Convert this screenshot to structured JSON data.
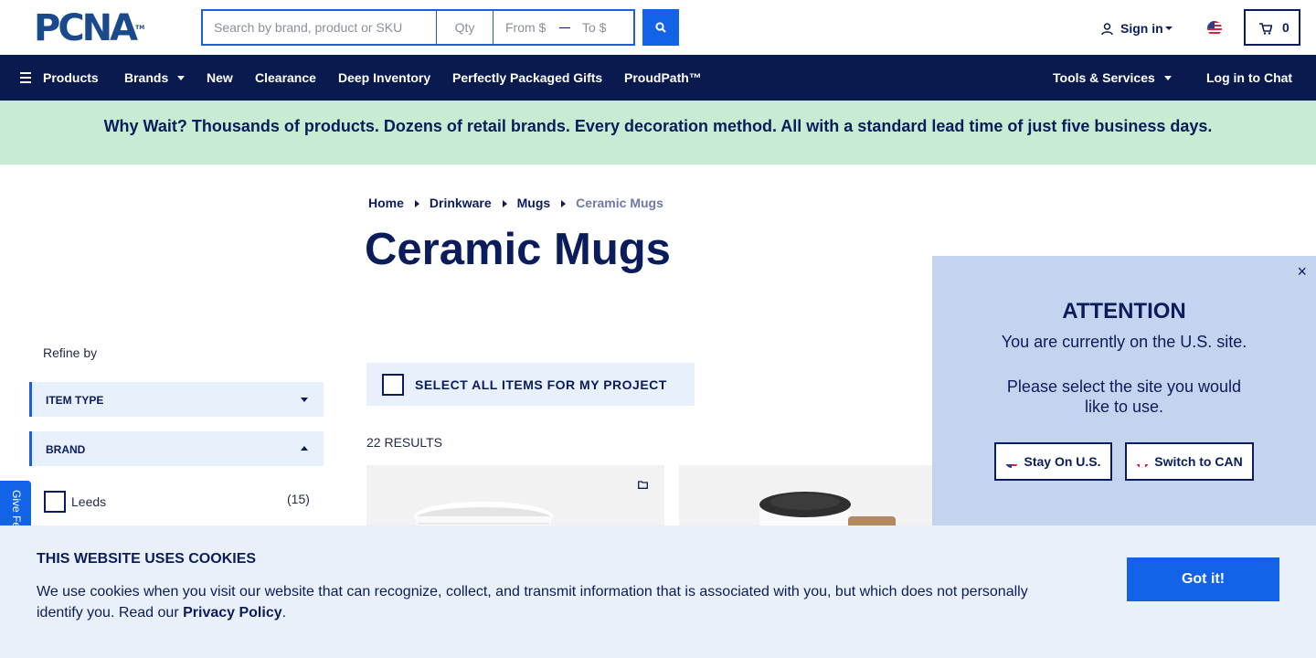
{
  "header": {
    "logo": "PCNA",
    "logo_mark": "TM",
    "search_placeholder": "Search by brand, product or SKU",
    "qty_placeholder": "Qty",
    "price_from_placeholder": "From $",
    "price_to_placeholder": "To $",
    "signin_label": "Sign in",
    "cart_count": "0"
  },
  "nav": {
    "products": "Products",
    "brands": "Brands",
    "new": "New",
    "clearance": "Clearance",
    "deep_inventory": "Deep Inventory",
    "gifts": "Perfectly Packaged Gifts",
    "proudpath": "ProudPath™",
    "tools": "Tools & Services",
    "chat": "Log in to Chat"
  },
  "promo": "Why Wait? Thousands of products. Dozens of retail brands. Every decoration method. All with a standard lead time of just five business days.",
  "breadcrumb": [
    "Home",
    "Drinkware",
    "Mugs",
    "Ceramic Mugs"
  ],
  "page_title": "Ceramic Mugs",
  "sidebar": {
    "refine_label": "Refine by",
    "facets": [
      "ITEM TYPE",
      "BRAND"
    ],
    "brand_option": {
      "label": "Leeds",
      "count": "(15)"
    },
    "feedback": "Give Feedback"
  },
  "main": {
    "select_all": "SELECT ALL ITEMS FOR MY PROJECT",
    "results": "22 RESULTS"
  },
  "modal": {
    "close": "×",
    "title": "ATTENTION",
    "line1": "You are currently on the U.S. site.",
    "line2": "Please select the site you would like to use.",
    "stay": "Stay On U.S.",
    "switch": "Switch to CAN"
  },
  "cookie": {
    "title": "THIS WEBSITE USES COOKIES",
    "text": "We use cookies when you visit our website that can recognize, collect, and transmit information that is associated with you, but which does not personally identify you. Read our ",
    "link": "Privacy Policy",
    "end": ".",
    "button": "Got it!"
  },
  "colors": {
    "navy": "#091a4e",
    "accent_blue": "#1263e8",
    "promo_green": "#c6edd4",
    "panel_blue": "#c4d3ee"
  },
  "icons": [
    "search-icon",
    "user-icon",
    "us-flag-icon",
    "cart-icon",
    "menu-icon",
    "folder-icon",
    "close-icon",
    "canada-flag-icon"
  ]
}
